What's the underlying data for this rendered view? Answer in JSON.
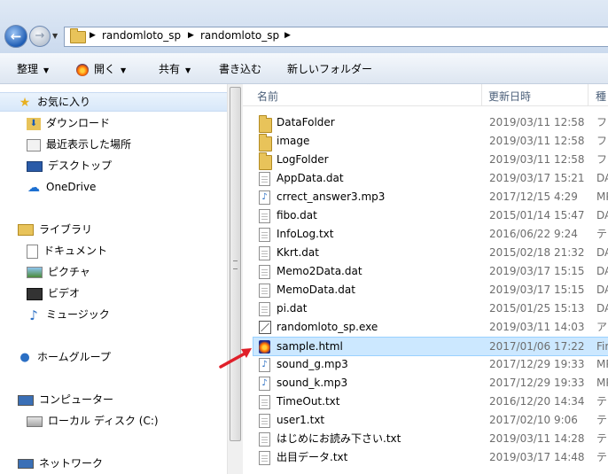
{
  "address": {
    "crumbs": [
      "randomloto_sp",
      "randomloto_sp"
    ]
  },
  "toolbar": {
    "organize": "整理",
    "open": "開く",
    "share": "共有",
    "burn": "書き込む",
    "new_folder": "新しいフォルダー"
  },
  "nav": {
    "favorites": "お気に入り",
    "downloads": "ダウンロード",
    "recent": "最近表示した場所",
    "desktop": "デスクトップ",
    "onedrive": "OneDrive",
    "libraries": "ライブラリ",
    "documents": "ドキュメント",
    "pictures": "ピクチャ",
    "videos": "ビデオ",
    "music": "ミュージック",
    "homegroup": "ホームグループ",
    "computer": "コンピューター",
    "local_disk": "ローカル ディスク (C:)",
    "network": "ネットワーク"
  },
  "columns": {
    "name": "名前",
    "date": "更新日時",
    "type": "種"
  },
  "files": [
    {
      "name": "DataFolder",
      "date": "2019/03/11 12:58",
      "type": "フ",
      "icon": "folder-icon"
    },
    {
      "name": "image",
      "date": "2019/03/11 12:58",
      "type": "フ",
      "icon": "folder-icon"
    },
    {
      "name": "LogFolder",
      "date": "2019/03/11 12:58",
      "type": "フ",
      "icon": "folder-icon"
    },
    {
      "name": "AppData.dat",
      "date": "2019/03/17 15:21",
      "type": "DA",
      "icon": "document-icon"
    },
    {
      "name": "crrect_answer3.mp3",
      "date": "2017/12/15 4:29",
      "type": "MP",
      "icon": "audio-file-icon"
    },
    {
      "name": "fibo.dat",
      "date": "2015/01/14 15:47",
      "type": "DA",
      "icon": "document-icon"
    },
    {
      "name": "InfoLog.txt",
      "date": "2016/06/22 9:24",
      "type": "テ",
      "icon": "document-icon"
    },
    {
      "name": "Kkrt.dat",
      "date": "2015/02/18 21:32",
      "type": "DA",
      "icon": "document-icon"
    },
    {
      "name": "Memo2Data.dat",
      "date": "2019/03/17 15:15",
      "type": "DA",
      "icon": "document-icon"
    },
    {
      "name": "MemoData.dat",
      "date": "2019/03/17 15:15",
      "type": "DA",
      "icon": "document-icon"
    },
    {
      "name": "pi.dat",
      "date": "2015/01/25 15:13",
      "type": "DA",
      "icon": "document-icon"
    },
    {
      "name": "randomloto_sp.exe",
      "date": "2019/03/11 14:03",
      "type": "ア",
      "icon": "application-icon"
    },
    {
      "name": "sample.html",
      "date": "2017/01/06 17:22",
      "type": "Fir",
      "icon": "html-file-icon"
    },
    {
      "name": "sound_g.mp3",
      "date": "2017/12/29 19:33",
      "type": "MP",
      "icon": "audio-file-icon"
    },
    {
      "name": "sound_k.mp3",
      "date": "2017/12/29 19:33",
      "type": "MP",
      "icon": "audio-file-icon"
    },
    {
      "name": "TimeOut.txt",
      "date": "2016/12/20 14:34",
      "type": "テ",
      "icon": "document-icon"
    },
    {
      "name": "user1.txt",
      "date": "2017/02/10 9:06",
      "type": "テ",
      "icon": "document-icon"
    },
    {
      "name": "はじめにお読み下さい.txt",
      "date": "2019/03/11 14:28",
      "type": "テ",
      "icon": "document-icon"
    },
    {
      "name": "出目データ.txt",
      "date": "2019/03/17 14:48",
      "type": "テ",
      "icon": "document-icon"
    }
  ],
  "selected_file": "sample.html",
  "colors": {
    "selection": "#cce8ff",
    "annotation_arrow": "#e0202a"
  }
}
